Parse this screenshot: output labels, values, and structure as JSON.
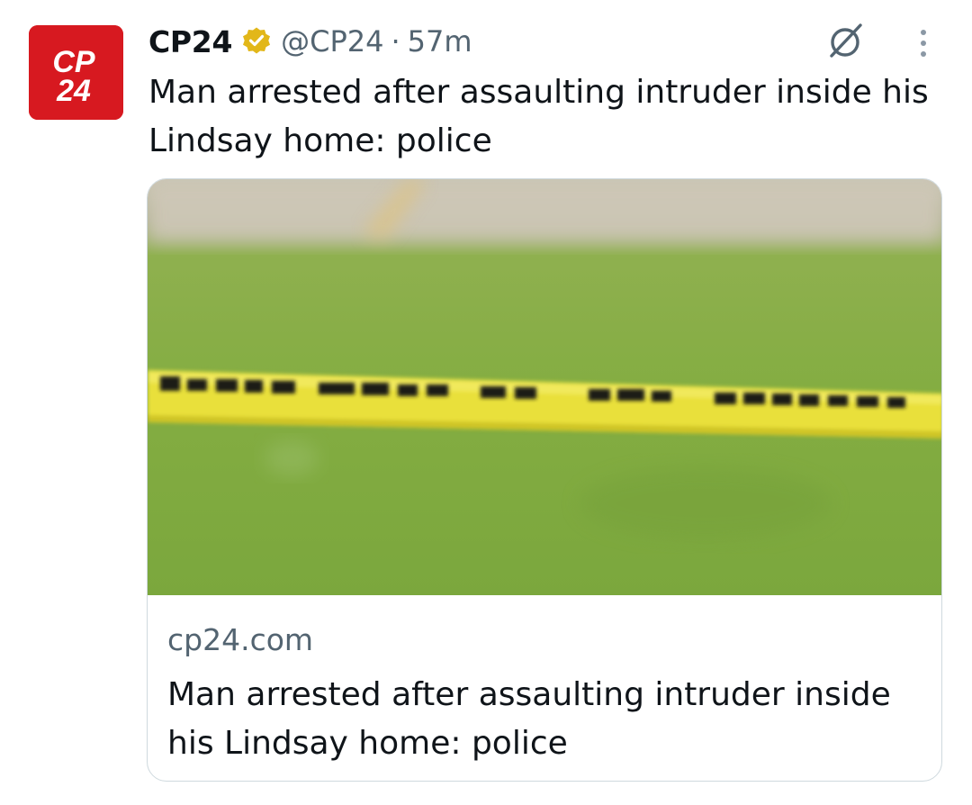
{
  "tweet": {
    "avatar": {
      "line1": "CP",
      "line2": "24",
      "color": "#d71920"
    },
    "display_name": "CP24",
    "verified_icon": "gold-verified-badge-icon",
    "handle": "@CP24",
    "separator": "·",
    "timestamp": "57m",
    "icons": [
      "grok-icon",
      "more-options-icon"
    ],
    "text": "Man arrested after assaulting intruder inside his Lindsay home: police"
  },
  "card": {
    "image_tape_text": "POLICE LINE DO NOT CROSS",
    "domain": "cp24.com",
    "title": "Man arrested after assaulting intruder inside his Lindsay home: police"
  }
}
